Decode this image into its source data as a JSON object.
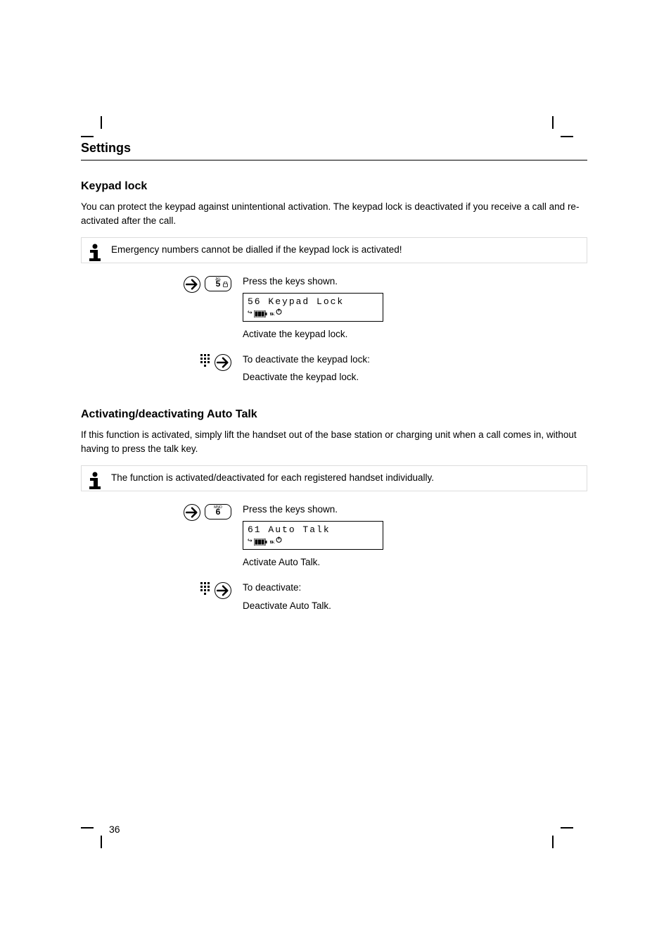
{
  "header": {
    "title": "Settings"
  },
  "section_keylock": {
    "title": "Keypad lock",
    "desc": "You can protect the keypad against unintentional activation. The keypad lock is deactivated if you receive a call and re-activated after the call.",
    "info": "Emergency numbers cannot be dialled if the keypad lock is activated!",
    "step_press": "Press the keys shown.",
    "lcd_line1": "56",
    "lcd_line2_label": "Keypad Lock",
    "step_activate": "Activate the keypad lock.",
    "step_deactivate1": "To deactivate the keypad lock:",
    "step_deactivate2": "Deactivate the keypad lock."
  },
  "section_autotalk": {
    "title": "Activating/deactivating Auto Talk",
    "desc": "If this function is activated, simply lift the handset out of the base station or charging unit when a call comes in, without having to press the talk key.",
    "info": "The function is activated/deactivated for each registered handset individually.",
    "step_press": "Press the keys shown.",
    "lcd_line1": "61",
    "lcd_line2_label": "Auto Talk",
    "step_activate": "Activate Auto Talk.",
    "step_deactivate1": "To deactivate:",
    "step_deactivate2": "Deactivate Auto Talk."
  },
  "keys": {
    "key5_top": "JKL",
    "key5_main": "5",
    "key6_top": "MNO",
    "key6_main": "6"
  },
  "page_number": "36"
}
